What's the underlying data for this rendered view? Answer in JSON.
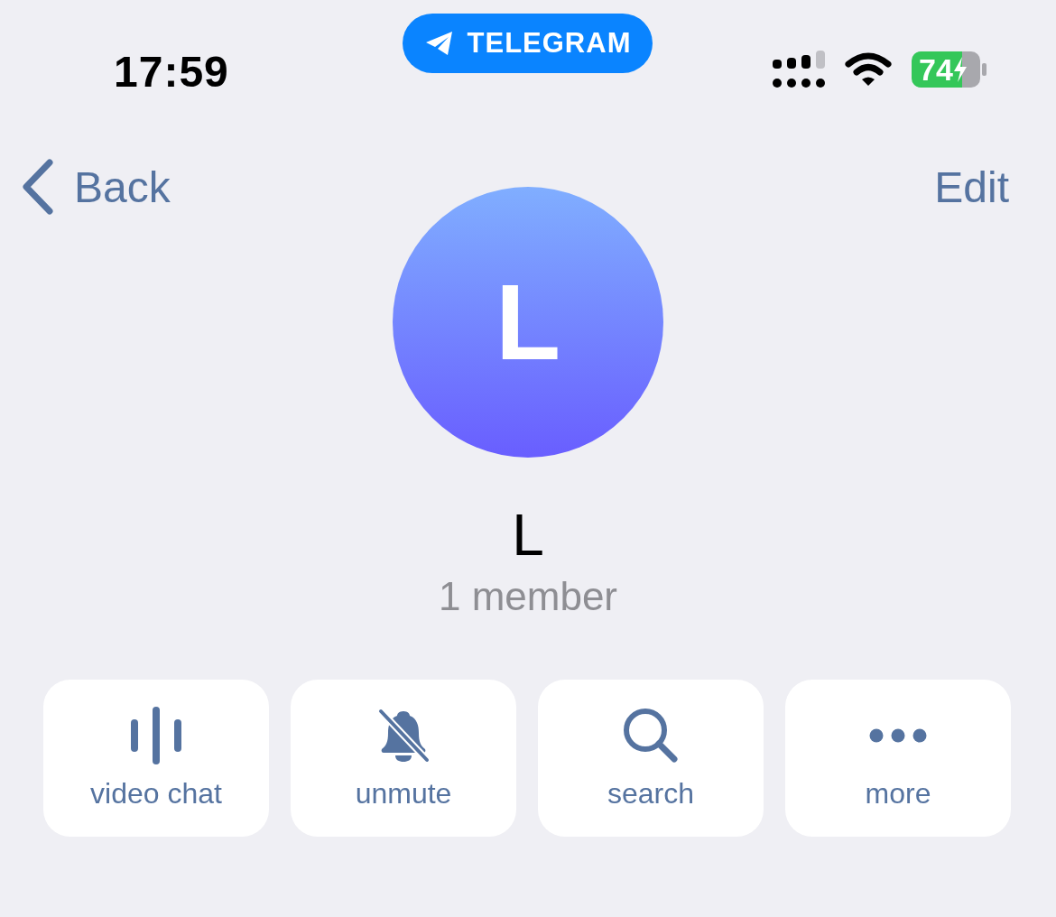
{
  "status_bar": {
    "time": "17:59",
    "app_pill": "TELEGRAM",
    "battery": "74"
  },
  "nav": {
    "back": "Back",
    "edit": "Edit"
  },
  "profile": {
    "avatar_letter": "L",
    "name": "L",
    "subtitle": "1 member"
  },
  "actions": [
    {
      "kind": "waveform",
      "label": "video chat"
    },
    {
      "kind": "bell-off",
      "label": "unmute"
    },
    {
      "kind": "search",
      "label": "search"
    },
    {
      "kind": "dots",
      "label": "more"
    }
  ]
}
